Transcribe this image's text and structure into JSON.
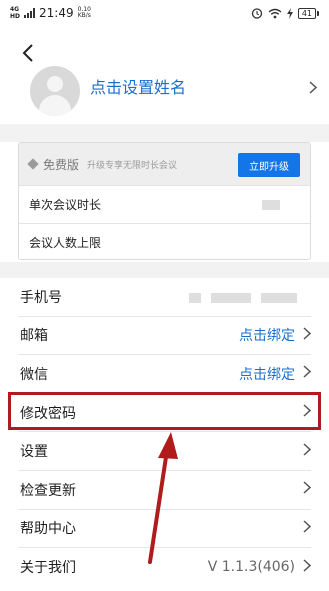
{
  "status_bar": {
    "network_tag": "4G",
    "network_tag2": "HD",
    "time": "21:49",
    "speed_value": "0.10",
    "speed_unit": "KB/s",
    "battery": "41"
  },
  "profile": {
    "name_prompt": "点击设置姓名"
  },
  "plan": {
    "name": "免费版",
    "description": "升级专享无限时长会议",
    "upgrade_label": "立即升级",
    "rows": [
      {
        "label": "单次会议时长"
      },
      {
        "label": "会议人数上限"
      }
    ]
  },
  "menu": {
    "items": [
      {
        "label": "手机号",
        "value": ""
      },
      {
        "label": "邮箱",
        "value": "点击绑定"
      },
      {
        "label": "微信",
        "value": "点击绑定"
      },
      {
        "label": "修改密码",
        "value": ""
      },
      {
        "label": "设置",
        "value": ""
      },
      {
        "label": "检查更新",
        "value": ""
      },
      {
        "label": "帮助中心",
        "value": ""
      },
      {
        "label": "关于我们",
        "value": "V 1.1.3(406)"
      }
    ]
  },
  "colors": {
    "link_blue": "#1a6fc9",
    "upgrade_blue": "#1476e6",
    "annotation_red": "#b01c1c"
  }
}
